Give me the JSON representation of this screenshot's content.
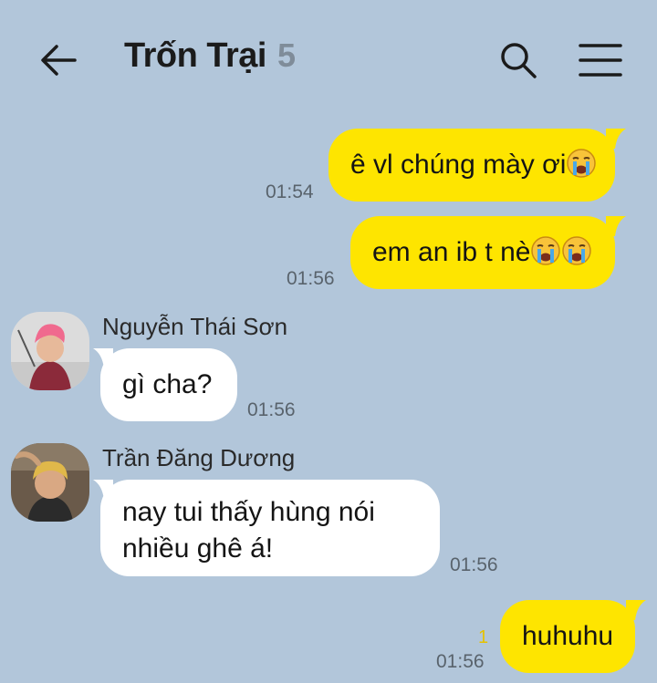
{
  "header": {
    "title": "Trốn Trại",
    "member_count": "5",
    "back_icon": "arrow-left-icon",
    "search_icon": "search-icon",
    "menu_icon": "hamburger-menu-icon"
  },
  "colors": {
    "background": "#b2c6da",
    "my_bubble": "#fee500",
    "other_bubble": "#ffffff",
    "unread": "#e5c200"
  },
  "messages": [
    {
      "from": "me",
      "text": "ê vl chúng mày ơi",
      "emoji": "loudly-crying-face",
      "time": "01:54"
    },
    {
      "from": "me",
      "text": "em an ib t nè",
      "emoji": "loudly-crying-face-x2",
      "time": "01:56"
    },
    {
      "from": "other",
      "sender": "Nguyễn Thái Sơn",
      "text": "gì cha?",
      "time": "01:56"
    },
    {
      "from": "other",
      "sender": "Trần Đăng Dương",
      "lines": [
        "nay tui thấy hùng nói",
        "nhiều ghê á!"
      ],
      "time": "01:56"
    },
    {
      "from": "me",
      "text": "huhuhu",
      "time": "01:56",
      "unread": "1"
    }
  ]
}
